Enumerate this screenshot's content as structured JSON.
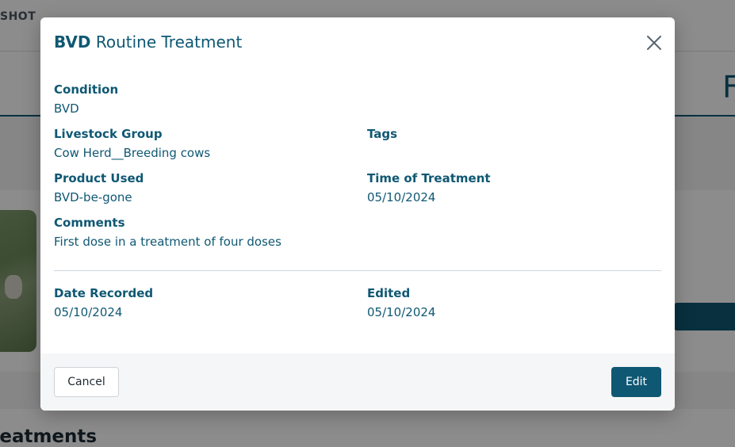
{
  "background": {
    "topbar_text": "SHOT",
    "band_letter": "F",
    "lower_title": "reatments"
  },
  "modal": {
    "title_strong": "BVD",
    "title_rest": "Routine Treatment",
    "close_icon": "close-icon",
    "fields": {
      "condition": {
        "label": "Condition",
        "value": "BVD"
      },
      "livestock_group": {
        "label": "Livestock Group",
        "value": "Cow Herd__Breeding cows"
      },
      "tags": {
        "label": "Tags",
        "value": ""
      },
      "product_used": {
        "label": "Product Used",
        "value": "BVD-be-gone"
      },
      "time_of_treatment": {
        "label": "Time of Treatment",
        "value": "05/10/2024"
      },
      "comments": {
        "label": "Comments",
        "value": "First dose in a treatment of four doses"
      },
      "date_recorded": {
        "label": "Date Recorded",
        "value": "05/10/2024"
      },
      "edited": {
        "label": "Edited",
        "value": "05/10/2024"
      }
    },
    "footer": {
      "cancel_label": "Cancel",
      "edit_label": "Edit"
    }
  },
  "colors": {
    "brand": "#0f5873",
    "overlay": "rgba(0,0,0,0.45)"
  }
}
